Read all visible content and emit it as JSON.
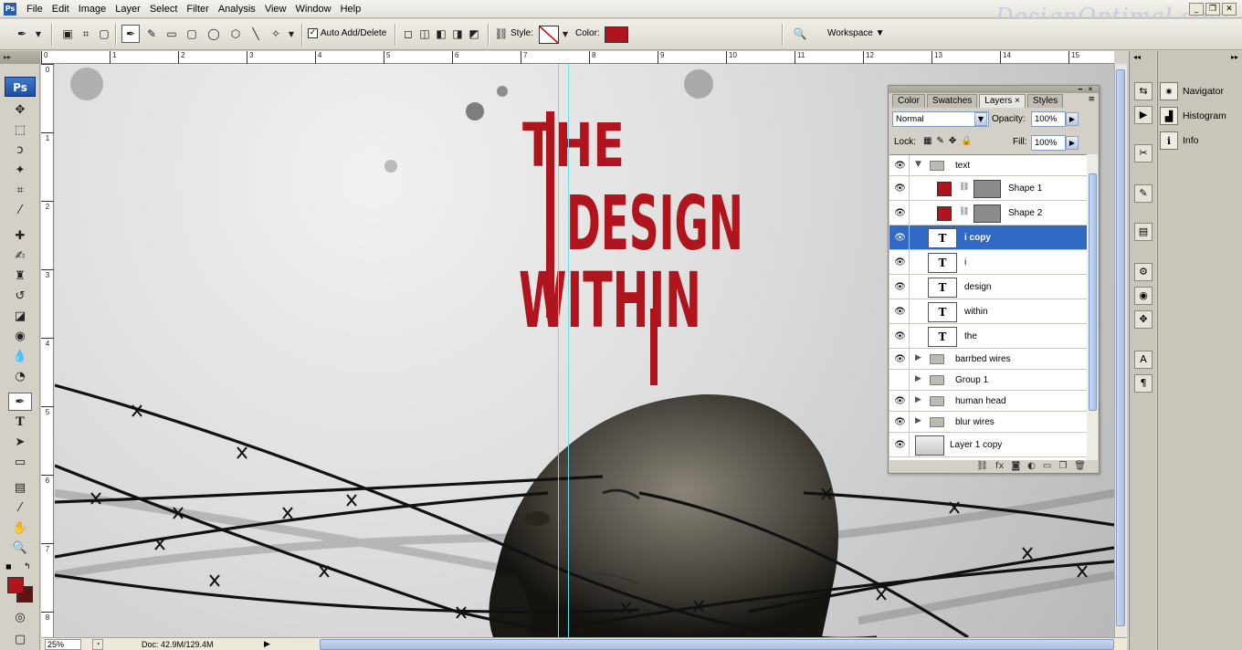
{
  "app": {
    "logo": "Ps",
    "watermark": "DesignOptimal.com"
  },
  "menu": {
    "items": [
      "File",
      "Edit",
      "Image",
      "Layer",
      "Select",
      "Filter",
      "Analysis",
      "View",
      "Window",
      "Help"
    ]
  },
  "window_controls": {
    "minimize": "_",
    "restore": "❐",
    "close": "✕"
  },
  "options_bar": {
    "auto_add_delete_label": "Auto Add/Delete",
    "auto_add_delete_checked": true,
    "style_label": "Style:",
    "color_label": "Color:",
    "color_value": "#b0141d",
    "workspace_label": "Workspace ▼"
  },
  "toolbox": {
    "header": "▸▸",
    "logo": "Ps",
    "foreground_color": "#b0141d",
    "background_color": "#5a1612"
  },
  "rulers": {
    "top": [
      "0",
      "1",
      "2",
      "3",
      "4",
      "5",
      "6",
      "7",
      "8",
      "9",
      "10",
      "11",
      "12",
      "13",
      "14",
      "15"
    ],
    "left": [
      "0",
      "1",
      "2",
      "3",
      "4",
      "5",
      "6",
      "7",
      "8"
    ]
  },
  "canvas": {
    "title_lines": [
      "THE",
      "DESIGN",
      "WITHIN"
    ]
  },
  "status": {
    "zoom": "25%",
    "doc": "Doc: 42.9M/129.4M"
  },
  "layers_panel": {
    "tabs": [
      "Color",
      "Swatches",
      "Layers ×",
      "Styles"
    ],
    "active_tab": "Layers ×",
    "blend_mode": "Normal",
    "opacity_label": "Opacity:",
    "opacity": "100%",
    "lock_label": "Lock:",
    "fill_label": "Fill:",
    "fill": "100%",
    "layers": [
      {
        "name": "text",
        "type": "group",
        "expanded": true,
        "visible": true
      },
      {
        "name": "Shape 1",
        "type": "shape",
        "visible": true,
        "color": "#b0141d"
      },
      {
        "name": "Shape 2",
        "type": "shape",
        "visible": true,
        "color": "#b0141d"
      },
      {
        "name": "i copy",
        "type": "text",
        "visible": true,
        "selected": true
      },
      {
        "name": "i",
        "type": "text",
        "visible": true
      },
      {
        "name": "design",
        "type": "text",
        "visible": true
      },
      {
        "name": "within",
        "type": "text",
        "visible": true
      },
      {
        "name": "the",
        "type": "text",
        "visible": true
      },
      {
        "name": "barrbed wires",
        "type": "group",
        "expanded": false,
        "visible": true
      },
      {
        "name": "Group 1",
        "type": "group",
        "expanded": false,
        "visible": false
      },
      {
        "name": "human head",
        "type": "group",
        "expanded": false,
        "visible": true
      },
      {
        "name": "blur wires",
        "type": "group",
        "expanded": false,
        "visible": true
      },
      {
        "name": "Layer 1 copy",
        "type": "pixel",
        "visible": true
      }
    ]
  },
  "right_dock": {
    "panels": [
      "Navigator",
      "Histogram",
      "Info"
    ]
  }
}
